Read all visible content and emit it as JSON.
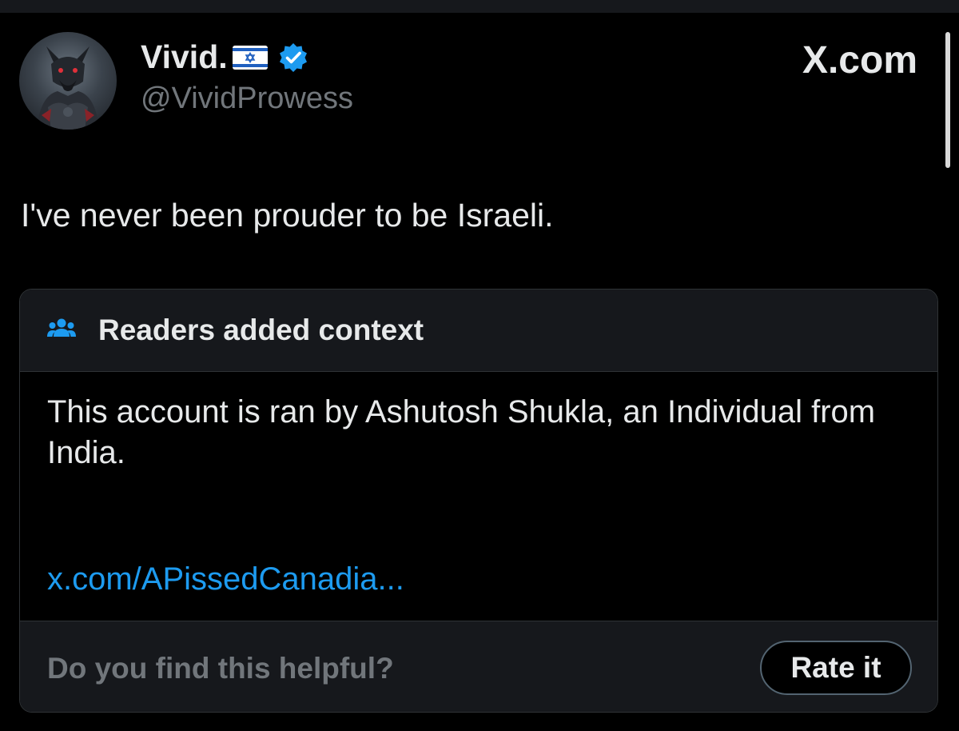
{
  "tweet": {
    "author": {
      "name": "Vivid.",
      "handle": "@VividProwess",
      "flag_icon": "israel-flag-emoji",
      "verified_icon": "verified-badge-icon"
    },
    "brand": "X.com",
    "text": "I've never been prouder to be Israeli."
  },
  "community_note": {
    "header_icon": "people-icon",
    "title": "Readers added context",
    "body": "This account is ran by Ashutosh Shukla, an Individual from India.",
    "link_text": "x.com/APissedCanadia...",
    "footer": {
      "question": "Do you find this helpful?",
      "rate_button": "Rate it"
    }
  },
  "colors": {
    "background": "#000000",
    "text_primary": "#e7e9ea",
    "text_secondary": "#71767b",
    "accent": "#1d9bf0",
    "card_border": "#2f3336",
    "card_panel": "#16181c"
  }
}
